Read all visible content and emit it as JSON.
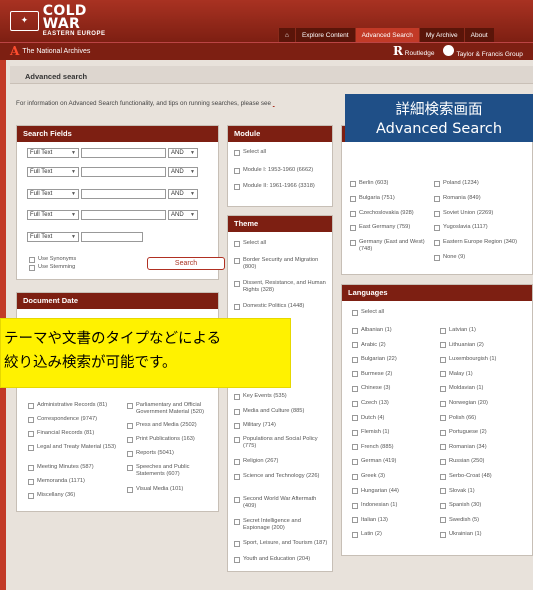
{
  "header": {
    "logo_line1": "COLD WAR",
    "logo_line2": "EASTERN EUROPE",
    "nav": [
      "Explore Content",
      "Advanced Search",
      "My Archive",
      "About"
    ],
    "home_icon": "home-icon",
    "national_archives": "The National Archives",
    "routledge": "Routledge",
    "tf": "Taylor & Francis Group"
  },
  "page": {
    "title": "Advanced search",
    "info": "For information on Advanced Search functionality, and tips on running searches, please see"
  },
  "search_fields": {
    "header": "Search Fields",
    "rows": [
      {
        "field": "Full Text",
        "op": "AND"
      },
      {
        "field": "Full Text",
        "op": "AND"
      },
      {
        "field": "Full Text",
        "op": "AND"
      },
      {
        "field": "Full Text",
        "op": "AND"
      },
      {
        "field": "Full Text",
        "op": ""
      }
    ],
    "use_synonyms": "Use Synonyms",
    "use_stemming": "Use Stemming",
    "search_button": "Search"
  },
  "document_date": {
    "header": "Document Date"
  },
  "document_types": [
    "Administrative Records (81)",
    "Correspondence (9747)",
    "Financial Records (81)",
    "Legal and Treaty Material (153)",
    "Meeting Minutes (587)",
    "Memoranda (1171)",
    "Miscellany (36)",
    "Parliamentary and Official Government Material (520)",
    "Press and Media (2502)",
    "Print Publications (163)",
    "Reports (5041)",
    "Speeches and Public Statements (607)",
    "Visual Media (101)"
  ],
  "module": {
    "header": "Module",
    "items": [
      "Select all",
      "Module I: 1953-1960 (6662)",
      "Module II: 1961-1966 (3318)"
    ]
  },
  "theme": {
    "header": "Theme",
    "items": [
      "Select all",
      "Border Security and Migration (800)",
      "Dissent, Resistance, and Human Rights (328)",
      "Domestic Politics (1448)",
      "Key Events (535)",
      "Media and Culture (885)",
      "Military (714)",
      "Populations and Social Policy (775)",
      "Religion (267)",
      "Science and Technology (226)",
      "Second World War Aftermath (409)",
      "Secret Intelligence and Espionage (200)",
      "Sport, Leisure, and Tourism (187)",
      "Youth and Education (204)"
    ]
  },
  "countries": {
    "left": [
      "Berlin (603)",
      "Bulgaria (751)",
      "Czechoslovakia (928)",
      "East Germany (759)",
      "Germany (East and West) (748)"
    ],
    "right": [
      "Poland (1234)",
      "Romania (849)",
      "Soviet Union (2269)",
      "Yugoslavia (1117)",
      "Eastern Europe Region (340)",
      "None (9)"
    ]
  },
  "languages": {
    "header": "Languages",
    "select_all": "Select all",
    "left": [
      "Albanian (1)",
      "Arabic (2)",
      "Bulgarian (22)",
      "Burmese (2)",
      "Chinese (3)",
      "Czech (13)",
      "Dutch (4)",
      "Flemish (1)",
      "French (885)",
      "German (419)",
      "Greek (3)",
      "Hungarian (44)",
      "Indonesian (1)",
      "Italian (13)",
      "Latin (2)"
    ],
    "right": [
      "Latvian (1)",
      "Lithuanian (2)",
      "Luxembourgish (1)",
      "Malay (1)",
      "Moldavian (1)",
      "Norwegian (20)",
      "Polish (66)",
      "Portuguese (2)",
      "Romanian (34)",
      "Russian (250)",
      "Serbo-Croat (48)",
      "Slovak (1)",
      "Spanish (30)",
      "Swedish (5)",
      "Ukrainian (1)"
    ]
  },
  "overlays": {
    "blue_line1": "詳細検索画面",
    "blue_line2": "Advanced Search",
    "yellow_line1": "テーマや文書のタイプなどによる",
    "yellow_line2": "絞り込み検索が可能です。"
  },
  "colors": {
    "brand_red": "#a93222",
    "dark_red": "#7d1f12",
    "overlay_blue": "#1f4f87",
    "overlay_yellow": "#fff200"
  }
}
